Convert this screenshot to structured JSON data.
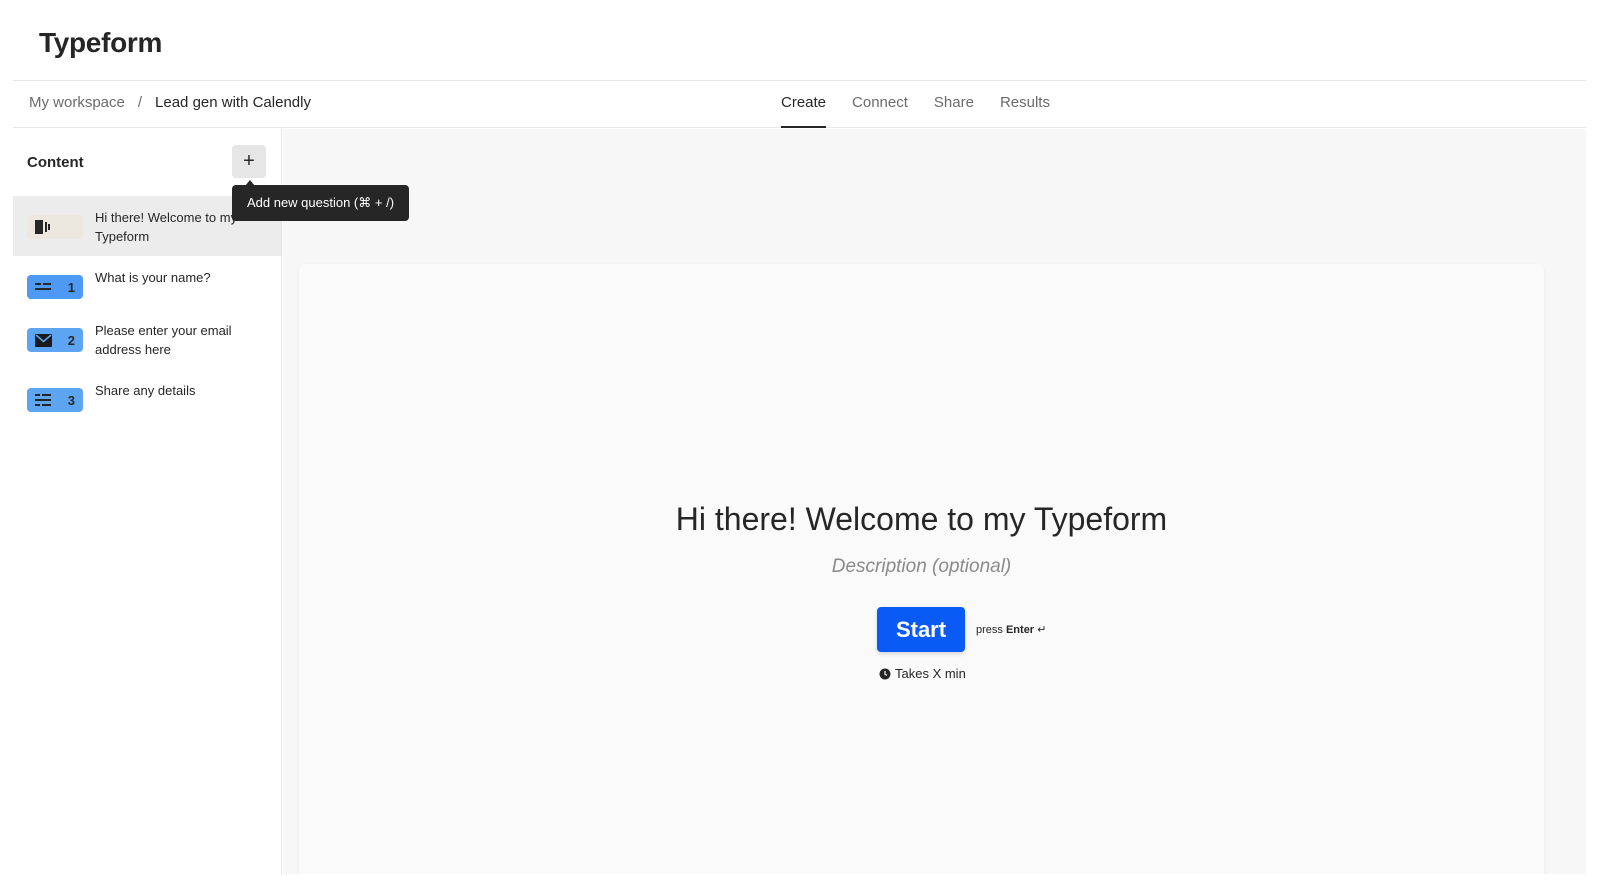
{
  "app": {
    "logo": "Typeform"
  },
  "breadcrumb": {
    "workspace": "My workspace",
    "separator": "/",
    "form": "Lead gen with Calendly"
  },
  "tabs": [
    {
      "label": "Create",
      "active": true
    },
    {
      "label": "Connect",
      "active": false
    },
    {
      "label": "Share",
      "active": false
    },
    {
      "label": "Results",
      "active": false
    }
  ],
  "sidebar": {
    "heading": "Content",
    "add_button": "+",
    "tooltip": "Add new question (⌘ + /)",
    "questions": [
      {
        "icon": "welcome-screen-icon",
        "number": "",
        "label": "Hi there! Welcome to my Typeform"
      },
      {
        "icon": "short-text-icon",
        "number": "1",
        "label": "What is your name?"
      },
      {
        "icon": "email-icon",
        "number": "2",
        "label": "Please enter your email address here"
      },
      {
        "icon": "long-text-icon",
        "number": "3",
        "label": "Share any details"
      }
    ]
  },
  "preview": {
    "title": "Hi there! Welcome to my Typeform",
    "description_placeholder": "Description (optional)",
    "start_button": "Start",
    "press_prefix": "press",
    "press_key": "Enter",
    "press_symbol": "↵",
    "time_text": "Takes X min"
  },
  "colors": {
    "primary": "#0a5bf6",
    "badge_blue": "#4d99f3",
    "text": "#262627"
  }
}
